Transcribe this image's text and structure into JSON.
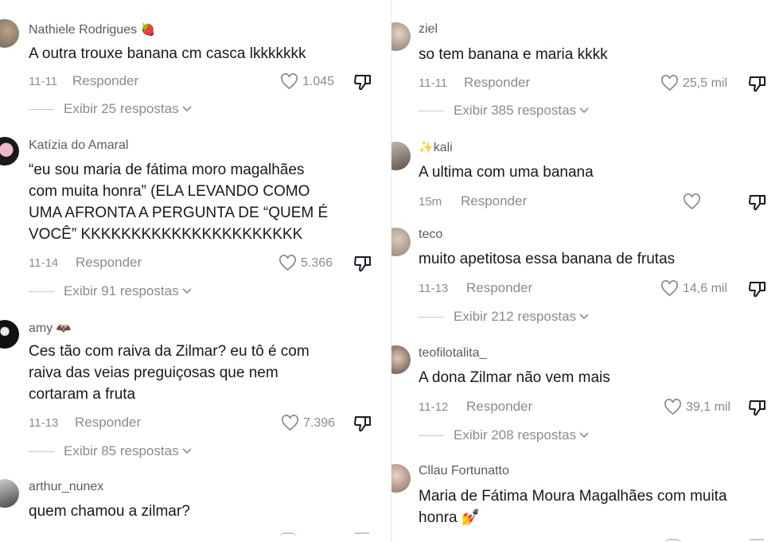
{
  "left": [
    {
      "username": "Nathiele Rodrigues",
      "emoji": "🍓",
      "lines": [
        "A outra trouxe banana cm casca lkkkkkkk"
      ],
      "date": "11-11",
      "reply": "Responder",
      "likes": "1.045",
      "replies": "Exibir 25 respostas"
    },
    {
      "username": "Katízia do Amaral",
      "emoji": "",
      "lines": [
        "“eu sou maria de fátima moro magalhães",
        "com muita honra” (ELA LEVANDO COMO",
        "UMA AFRONTA A PERGUNTA DE “QUEM É",
        "VOCÊ” KKKKKKKKKKKKKKKKKKKKKK"
      ],
      "date": "11-14",
      "reply": "Responder",
      "likes": "5.366",
      "replies": "Exibir 91 respostas"
    },
    {
      "username": "amy",
      "emoji": "🦇",
      "lines": [
        "Ces tão com raiva da Zilmar? eu tô é com",
        "raiva das veias preguiçosas que nem",
        "cortaram a fruta"
      ],
      "date": "11-13",
      "reply": "Responder",
      "likes": "7.396",
      "replies": "Exibir 85 respostas"
    },
    {
      "username": "arthur_nunex",
      "emoji": "",
      "lines": [
        "quem chamou a zilmar?"
      ]
    }
  ],
  "right": [
    {
      "username": "ziel",
      "emoji": "",
      "lines": [
        "so tem banana e maria kkkk"
      ],
      "date": "11-11",
      "reply": "Responder",
      "likes": "25,5 mil",
      "replies": "Exibir 385 respostas"
    },
    {
      "username": "kali",
      "emoji": "✨",
      "lines": [
        "A ultima com uma banana"
      ],
      "date": "15m",
      "reply": "Responder",
      "likes": "",
      "replies": ""
    },
    {
      "username": "teco",
      "emoji": "",
      "lines": [
        "muito apetitosa essa banana de frutas"
      ],
      "date": "11-13",
      "reply": "Responder",
      "likes": "14,6 mil",
      "replies": "Exibir 212 respostas"
    },
    {
      "username": "teofilotalita_",
      "emoji": "",
      "lines": [
        "A dona Zilmar não vem mais"
      ],
      "date": "11-12",
      "reply": "Responder",
      "likes": "39,1 mil",
      "replies": "Exibir 208 respostas"
    },
    {
      "username": "Cllau Fortunatto",
      "emoji": "",
      "lines": [
        "Maria de Fátima Moura Magalhães com muita",
        "honra"
      ],
      "trailing_emoji": "💅"
    }
  ],
  "icons": {
    "like": "heart-outline-icon",
    "dislike": "thumbs-down-outline-icon",
    "expand": "chevron-down-icon"
  },
  "colors": {
    "text": "#161823",
    "secondary": "#8a8b91",
    "username": "#5a5b63"
  }
}
